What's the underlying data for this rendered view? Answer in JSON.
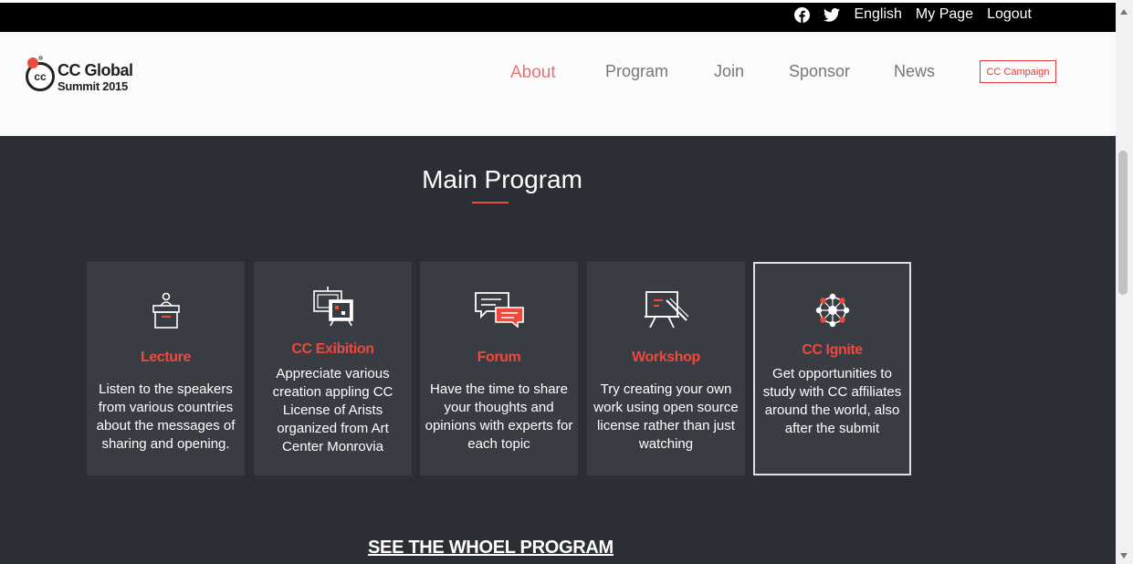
{
  "topbar": {
    "icons": [
      "facebook-icon",
      "twitter-icon"
    ],
    "links": [
      "English",
      "My Page",
      "Logout"
    ]
  },
  "logo": {
    "line1": "CC Global",
    "line2": "Summit 2015",
    "badge": "cc"
  },
  "nav": {
    "items": [
      "About",
      "Program",
      "Join",
      "Sponsor",
      "News"
    ],
    "active": "About",
    "campaign": "CC Campaign"
  },
  "main": {
    "heading": "Main Program",
    "cards": [
      {
        "title": "Lecture",
        "icon": "lecture-podium-icon",
        "desc": "Listen to the speakers from various countries about the messages of sharing and opening."
      },
      {
        "title": "CC Exibition",
        "icon": "exhibition-board-icon",
        "desc": "Appreciate various creation appling CC License of Arists organized from Art Center Monrovia"
      },
      {
        "title": "Forum",
        "icon": "forum-chat-icon",
        "desc": "Have the time to share your thoughts and opinions with experts for each topic"
      },
      {
        "title": "Workshop",
        "icon": "workshop-easel-icon",
        "desc": "Try creating your own work using open source license rather than just watching"
      },
      {
        "title": "CC Ignite",
        "icon": "ignite-network-icon",
        "desc": "Get opportunities to study with CC affiliates around the world, also after the submit"
      }
    ],
    "see_all": "SEE THE WHOEL PROGRAM"
  },
  "colors": {
    "accent": "#e74c3c",
    "dark_bg": "#2c2e35",
    "card_bg": "#3a3c44"
  }
}
